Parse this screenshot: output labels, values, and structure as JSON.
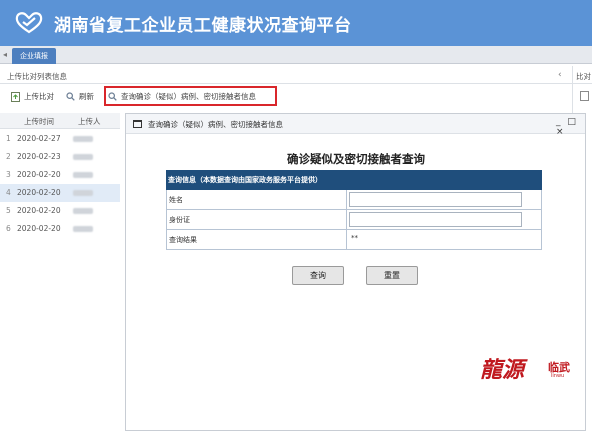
{
  "app": {
    "title": "湖南省复工企业员工健康状况查询平台"
  },
  "tabs": [
    {
      "label": "企业填报"
    }
  ],
  "panel": {
    "title": "上传比对列表信息",
    "right_label": "比对"
  },
  "toolbar": {
    "upload_label": "上传比对",
    "refresh_label": "刷新",
    "query_label": "查询确诊（疑似）病例、密切接触者信息"
  },
  "list": {
    "columns": [
      "上传时间",
      "上传人"
    ],
    "rows": [
      {
        "num": "1",
        "date": "2020-02-27"
      },
      {
        "num": "2",
        "date": "2020-02-23"
      },
      {
        "num": "3",
        "date": "2020-02-20"
      },
      {
        "num": "4",
        "date": "2020-02-20"
      },
      {
        "num": "5",
        "date": "2020-02-20"
      },
      {
        "num": "6",
        "date": "2020-02-20"
      }
    ],
    "selected_index": 3
  },
  "modal": {
    "title": "查询确诊（疑似）病例、密切接触者信息",
    "controls": "_ □ ×",
    "form_title": "确诊疑似及密切接触者查询",
    "table_header": "查询信息（本数据查询由国家政务服务平台提供）",
    "fields": [
      {
        "label": "姓名",
        "value": ""
      },
      {
        "label": "身份证",
        "value": ""
      },
      {
        "label": "查询结果",
        "value": "**"
      }
    ],
    "query_button": "查询",
    "reset_button": "重置"
  },
  "watermark": {
    "big": "龍源",
    "small": "临武",
    "sub": "linwu"
  },
  "colors": {
    "header_bg": "#5b93d6",
    "tab_bg": "#4d7fbf",
    "table_header_bg": "#1f4e7c",
    "highlight_border": "#d9262b",
    "watermark": "#c0191f"
  }
}
